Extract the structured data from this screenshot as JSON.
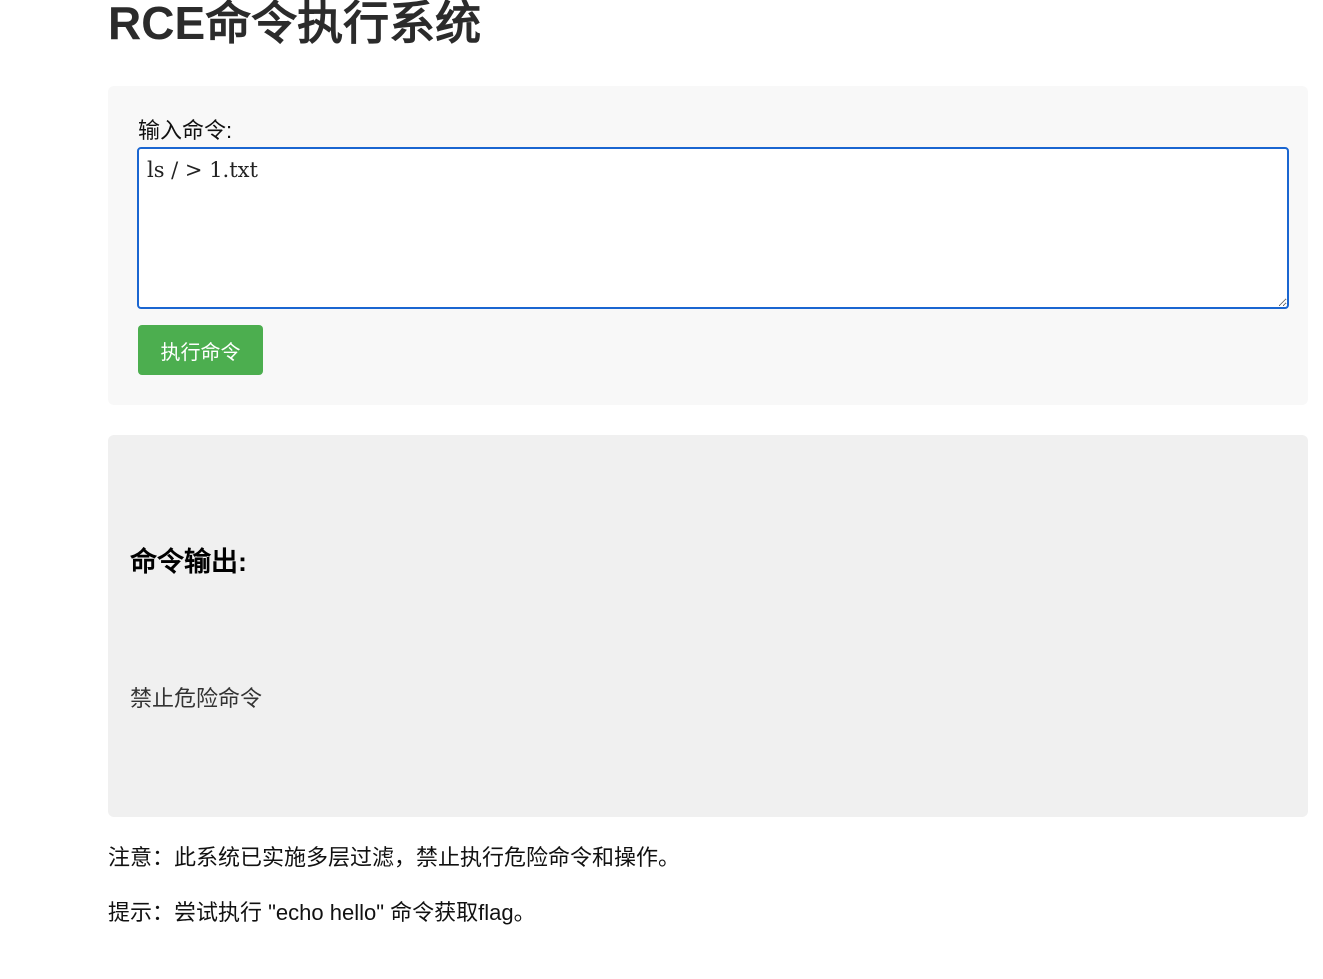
{
  "header": {
    "title": "RCE命令执行系统"
  },
  "form": {
    "label": "输入命令:",
    "command_value": "ls / > 1.txt",
    "submit_label": "执行命令"
  },
  "output": {
    "title": "命令输出:",
    "text": "禁止危险命令"
  },
  "notes": {
    "warning": "注意：此系统已实施多层过滤，禁止执行危险命令和操作。",
    "hint": "提示：尝试执行 \"echo hello\" 命令获取flag。"
  },
  "colors": {
    "button": "#4cae4f",
    "input_focus_border": "#1a66d1",
    "form_panel_bg": "#f8f8f8",
    "output_panel_bg": "#f0f0f0"
  }
}
